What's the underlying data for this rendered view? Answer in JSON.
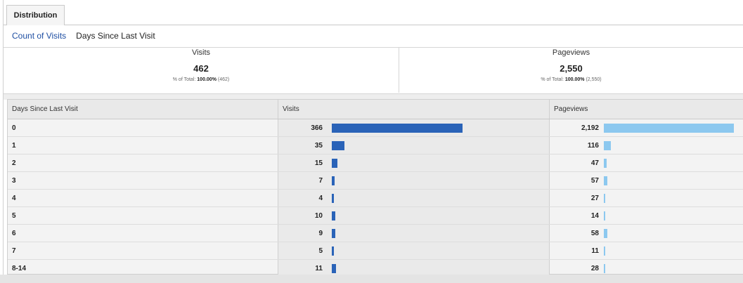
{
  "tabs": [
    {
      "label": "Distribution"
    }
  ],
  "sublinks": {
    "count_of_visits": "Count of Visits",
    "days_since_last_visit": "Days Since Last Visit"
  },
  "summary": {
    "visits": {
      "label": "Visits",
      "value": "462",
      "pct_prefix": "% of Total: ",
      "pct": "100.00%",
      "pct_total": " (462)"
    },
    "pageviews": {
      "label": "Pageviews",
      "value": "2,550",
      "pct_prefix": "% of Total: ",
      "pct": "100.00%",
      "pct_total": " (2,550)"
    }
  },
  "table": {
    "columns": [
      "Days Since Last Visit",
      "Visits",
      "Pageviews"
    ],
    "rows": [
      {
        "days": "0",
        "visits": "366",
        "pageviews": "2,192"
      },
      {
        "days": "1",
        "visits": "35",
        "pageviews": "116"
      },
      {
        "days": "2",
        "visits": "15",
        "pageviews": "47"
      },
      {
        "days": "3",
        "visits": "7",
        "pageviews": "57"
      },
      {
        "days": "4",
        "visits": "4",
        "pageviews": "27"
      },
      {
        "days": "5",
        "visits": "10",
        "pageviews": "14"
      },
      {
        "days": "6",
        "visits": "9",
        "pageviews": "58"
      },
      {
        "days": "7",
        "visits": "5",
        "pageviews": "11"
      },
      {
        "days": "8-14",
        "visits": "11",
        "pageviews": "28"
      }
    ]
  },
  "colors": {
    "visits_bar": "#2a63b8",
    "pageviews_bar": "#8cc8ef",
    "link": "#1f4fa3"
  }
}
